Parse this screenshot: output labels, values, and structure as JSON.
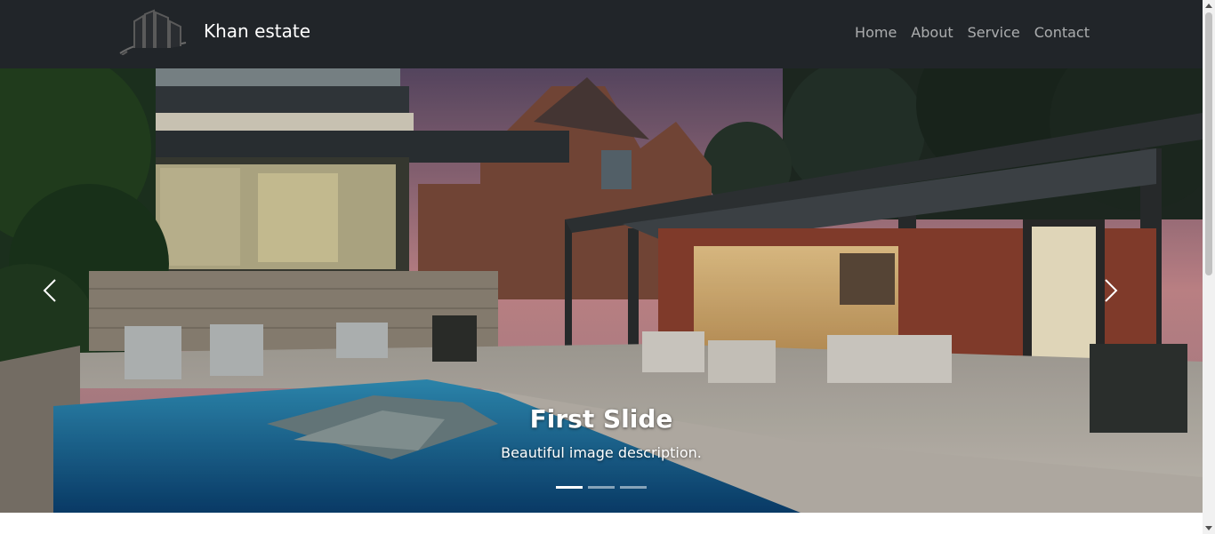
{
  "navbar": {
    "brand": "Khan estate",
    "links": [
      "Home",
      "About",
      "Service",
      "Contact"
    ]
  },
  "carousel": {
    "caption_title": "First Slide",
    "caption_text": "Beautiful image description.",
    "slide_count": 3,
    "active_index": 0
  },
  "colors": {
    "navbar_bg": "#212529",
    "brand_text": "#ffffff",
    "nav_link": "#9a9c9e"
  },
  "icons": {
    "prev": "chevron-left-icon",
    "next": "chevron-right-icon"
  }
}
